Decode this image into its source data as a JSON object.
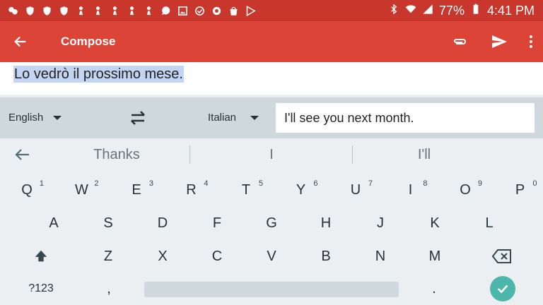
{
  "status_bar": {
    "notification_icons": [
      "chat-icon",
      "shield-icon",
      "shield-icon",
      "shield-icon",
      "chess-pawn-icon",
      "chess-pawn-icon",
      "chess-pawn-icon",
      "chess-pawn-icon",
      "chess-pawn-icon",
      "speech-bubble-icon",
      "image-icon",
      "check-circle-icon",
      "refresh-icon",
      "shopping-bag-icon",
      "play-store-icon"
    ],
    "battery": "77%",
    "time": "4:41 PM"
  },
  "app_bar": {
    "title": "Compose",
    "bg_color": "#db4437"
  },
  "compose": {
    "text": "Lo vedrò il prossimo mese."
  },
  "translate_bar": {
    "source_lang": "English",
    "target_lang": "Italian",
    "translation": "I'll see you next month."
  },
  "suggestions": [
    "Thanks",
    "I",
    "I'll"
  ],
  "keyboard": {
    "row1": [
      {
        "k": "Q",
        "n": "1"
      },
      {
        "k": "W",
        "n": "2"
      },
      {
        "k": "E",
        "n": "3"
      },
      {
        "k": "R",
        "n": "4"
      },
      {
        "k": "T",
        "n": "5"
      },
      {
        "k": "Y",
        "n": "6"
      },
      {
        "k": "U",
        "n": "7"
      },
      {
        "k": "I",
        "n": "8"
      },
      {
        "k": "O",
        "n": "9"
      },
      {
        "k": "P",
        "n": "0"
      }
    ],
    "row2": [
      "A",
      "S",
      "D",
      "F",
      "G",
      "H",
      "J",
      "K",
      "L"
    ],
    "row3": [
      "Z",
      "X",
      "C",
      "V",
      "B",
      "N",
      "M"
    ],
    "symbols_label": "?123",
    "comma": ",",
    "period": ".",
    "done_color": "#4db6ac"
  }
}
